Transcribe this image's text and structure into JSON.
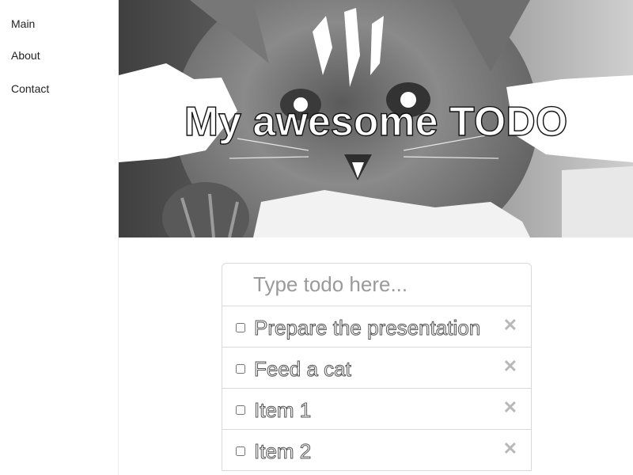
{
  "sidebar": {
    "items": [
      {
        "label": "Main"
      },
      {
        "label": "About"
      },
      {
        "label": "Contact"
      }
    ]
  },
  "hero": {
    "title": "My awesome TODO",
    "image": "kitten-photo"
  },
  "todo": {
    "input_placeholder": "Type todo here...",
    "input_value": "",
    "items": [
      {
        "label": "Prepare the presentation",
        "checked": false
      },
      {
        "label": "Feed a cat",
        "checked": false
      },
      {
        "label": "Item 1",
        "checked": false
      },
      {
        "label": "Item 2",
        "checked": false
      }
    ],
    "delete_glyph": "✕"
  }
}
